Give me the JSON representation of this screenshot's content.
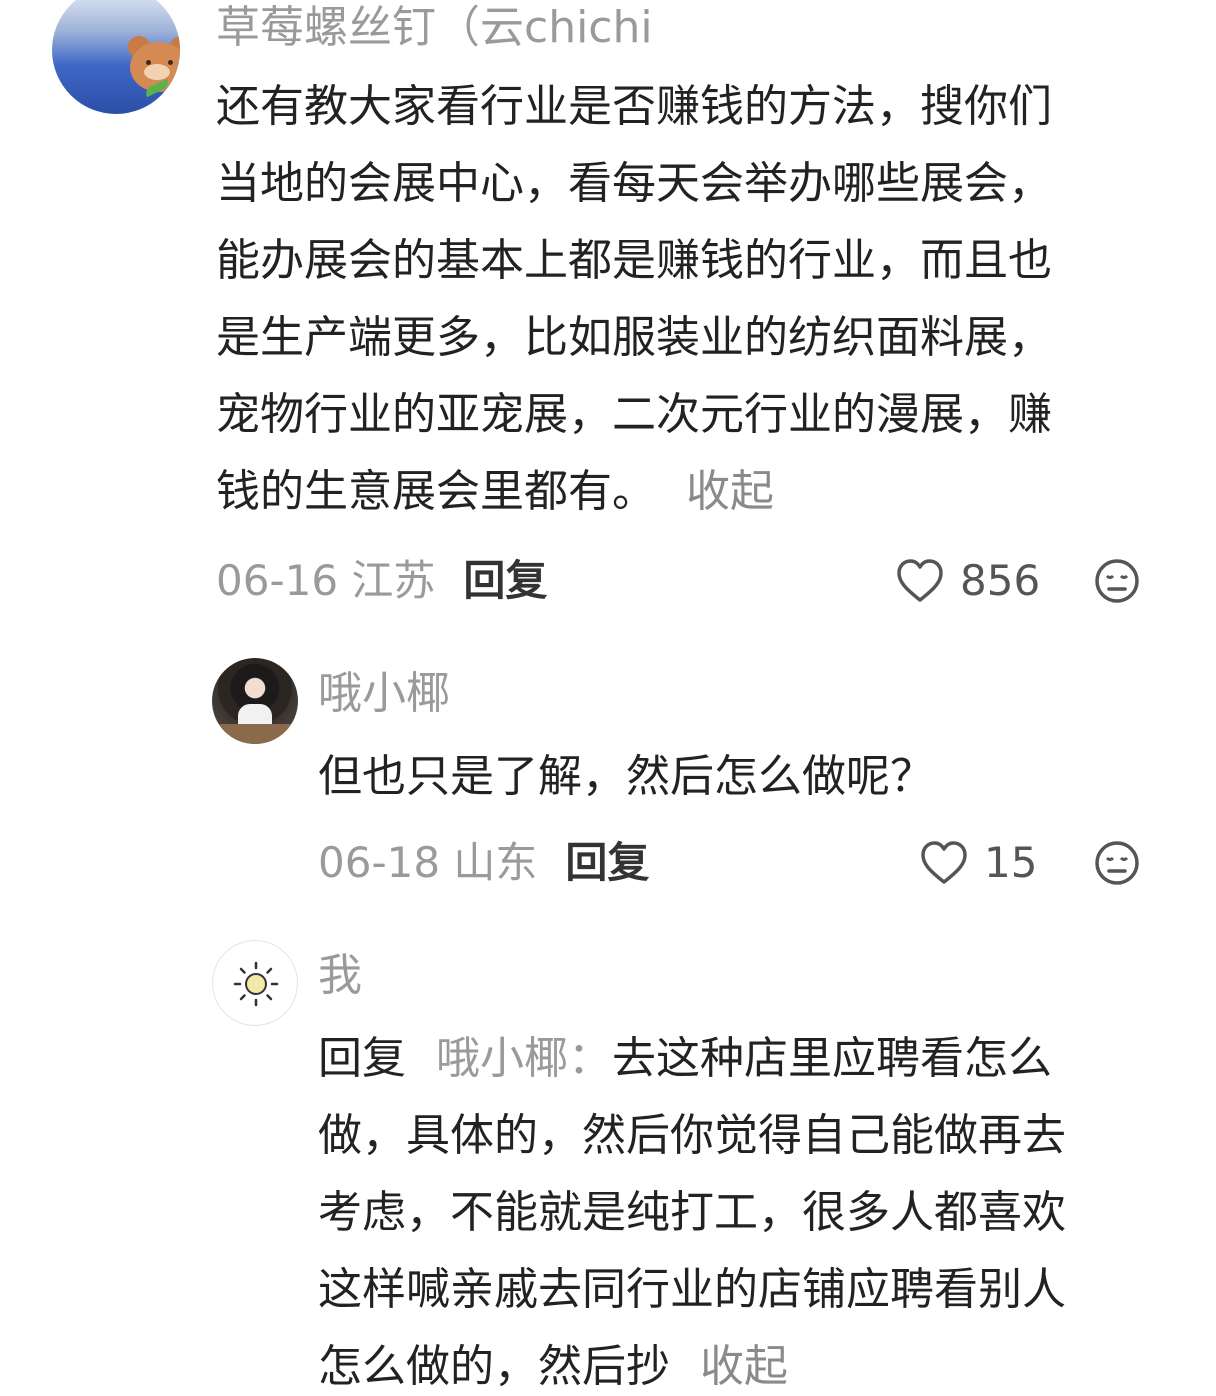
{
  "comments": [
    {
      "username": "草莓螺丝钉（云chichi",
      "lines": [
        "还有教大家看行业是否赚钱的方法，搜你们",
        "当地的会展中心，看每天会举办哪些展会，",
        "能办展会的基本上都是赚钱的行业，而且也",
        "是生产端更多，比如服装业的纺织面料展，",
        "宠物行业的亚宠展，二次元行业的漫展，赚",
        "钱的生意展会里都有。"
      ],
      "collapse": "收起",
      "date_location": "06-16 江苏",
      "reply": "回复",
      "likes": "856"
    },
    {
      "username": "哦小椰",
      "lines": [
        "但也只是了解，然后怎么做呢？"
      ],
      "date_location": "06-18 山东",
      "reply": "回复",
      "likes": "15"
    },
    {
      "username": "我",
      "reply_prefix": "回复",
      "reply_target": "哦小椰：",
      "first_line_rest": "去这种店里应聘看怎么",
      "lines": [
        "做，具体的，然后你觉得自己能做再去",
        "考虑，不能就是纯打工，很多人都喜欢",
        "这样喊亲戚去同行业的店铺应聘看别人",
        "怎么做的，然后抄"
      ],
      "collapse": "收起"
    }
  ],
  "icons": {
    "like": "heart-outline-icon",
    "dislike": "neutral-face-icon"
  },
  "colors": {
    "text": "#222222",
    "muted": "#9a9a9a",
    "icon": "#555555"
  }
}
